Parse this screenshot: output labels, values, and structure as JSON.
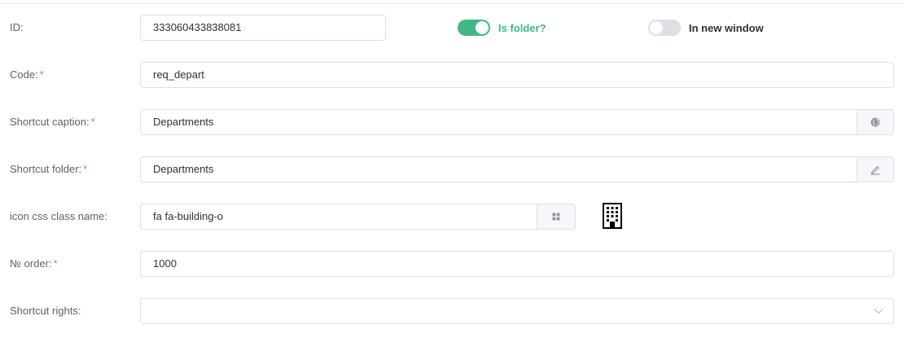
{
  "form": {
    "id": {
      "label": "ID:",
      "value": "333060433838081"
    },
    "is_folder": {
      "label": "Is folder?",
      "on": true
    },
    "in_new_window": {
      "label": "In new window",
      "on": false
    },
    "code": {
      "label": "Code:",
      "required_mark": "*",
      "value": "req_depart"
    },
    "shortcut_caption": {
      "label": "Shortcut caption:",
      "required_mark": "*",
      "value": "Departments",
      "addon_icon": "globe-icon"
    },
    "shortcut_folder": {
      "label": "Shortcut folder:",
      "required_mark": "*",
      "value": "Departments",
      "addon_icon": "edit-icon"
    },
    "icon_css": {
      "label": "icon css class name:",
      "value": "fa fa-building-o",
      "addon_icon": "grid-icon",
      "preview_icon": "building-icon"
    },
    "order": {
      "label": "№ order:",
      "required_mark": "*",
      "value": "1000"
    },
    "shortcut_rights": {
      "label": "Shortcut rights:",
      "value": "",
      "dropdown_icon": "chevron-down-icon"
    }
  },
  "colors": {
    "accent": "#41b883",
    "switch_off": "#dcdfe6",
    "required": "#f56c6c",
    "border": "#dcdfe6"
  }
}
